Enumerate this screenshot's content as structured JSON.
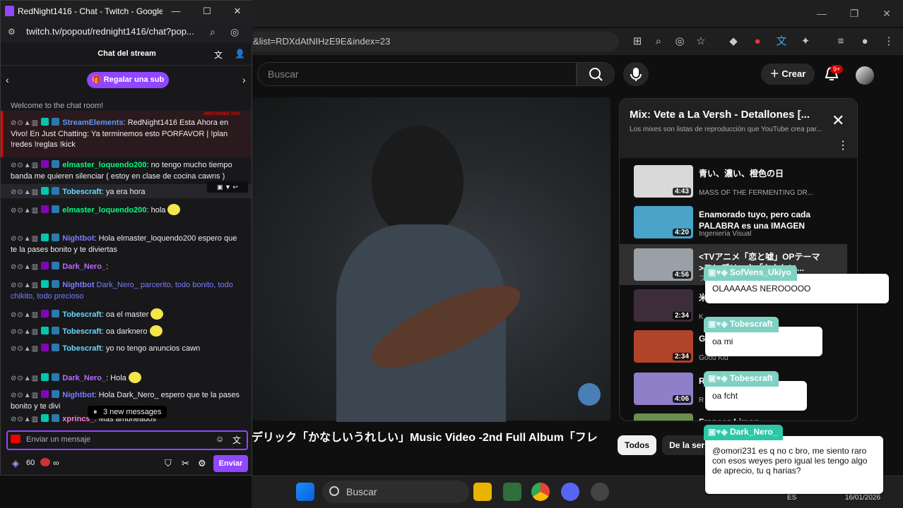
{
  "chrome": {
    "url_fragment": "&list=RDXdAtNIHzE9E&index=23",
    "window_controls": [
      "—",
      "❐",
      "✕"
    ]
  },
  "youtube": {
    "search_placeholder": "Buscar",
    "create_label": "Crear",
    "notif_badge": "9+",
    "video_title": "デリック「かなしいうれしい」Music Video -2nd Full Album「フレ",
    "filters": [
      "Todos",
      "De la serie"
    ],
    "playlist": {
      "title": "Mix: Vete a La Versh - Detallones [...",
      "subtitle": "Los mixes son listas de reproducción que YouTube crea par...",
      "items": [
        {
          "title": "青い、濃い、橙色の日",
          "channel": "MASS OF THE FERMENTING DR...",
          "duration": "4:43",
          "color": "#d9d9d9"
        },
        {
          "title": "Enamorado tuyo, pero cada PALABRA es una IMAGEN de...",
          "channel": "Ingeniería Visual",
          "duration": "4:20",
          "color": "#4aa3c9"
        },
        {
          "title": "<TVアニメ「恋と嘘」OPテーマ>フレデリック「かなしい...",
          "channel": "フ",
          "duration": "4:56",
          "color": "#9aa0a8"
        },
        {
          "title": "米 OUT",
          "channel": "K",
          "duration": "2:34",
          "color": "#3d2c3a"
        },
        {
          "title": "G (",
          "channel": "Good Kid",
          "duration": "2:34",
          "color": "#b0442a"
        },
        {
          "title": "R M",
          "channel": "R",
          "duration": "4:06",
          "color": "#8f7fc8"
        },
        {
          "title": "Frances Limon",
          "channel": "",
          "duration": "",
          "color": "#6a8f4e"
        }
      ]
    }
  },
  "taskbar": {
    "search_label": "Buscar",
    "lang": "ES",
    "date": "16/01/2026"
  },
  "twitch": {
    "window_title": "RedNight1416 - Chat - Twitch - Google...",
    "url": "twitch.tv/popout/rednight1416/chat?pop...",
    "header_title": "Chat del stream",
    "gift_label": "Regalar una sub",
    "welcome": "Welcome to the chat room!",
    "mentions_tag": "MENTIONED YOU",
    "messages": [
      {
        "user": "StreamElements",
        "color": "#5d98f2",
        "text": ": RedNight1416 Esta Ahora en Vivo! En Just Chatting: Ya terminemos esto PORFAVOR | !plan !redes !reglas !kick"
      },
      {
        "user": "elmaster_loquendo200",
        "color": "#00ff7f",
        "text": ": no tengo mucho tiempo banda me quieren silenciar ( estoy en clase de cocina cawns )"
      },
      {
        "user": "Tobescraft",
        "color": "#6ad8ff",
        "text": ": ya era hora"
      },
      {
        "user": "elmaster_loquendo200",
        "color": "#00ff7f",
        "text": ": hola"
      },
      {
        "user": "Nightbot",
        "color": "#7c7cff",
        "text": ": Hola elmaster_loquendo200 espero que te la pases bonito y te diviertas"
      },
      {
        "user": "Dark_Nero_",
        "color": "#b56cff",
        "text": ":"
      },
      {
        "user": "Nightbot",
        "color": "#7c7cff",
        "text": " Dark_Nero_ parcerito, todo bonito, todo chikito, todo precioso"
      },
      {
        "user": "Tobescraft",
        "color": "#6ad8ff",
        "text": ": oa el master"
      },
      {
        "user": "Tobescraft",
        "color": "#6ad8ff",
        "text": ": oa darknero"
      },
      {
        "user": "Tobescraft",
        "color": "#6ad8ff",
        "text": ": yo no tengo anuncios cawn"
      },
      {
        "user": "Dark_Nero_",
        "color": "#b56cff",
        "text": ": Hola"
      },
      {
        "user": "Nightbot",
        "color": "#7c7cff",
        "text": ": Hola Dark_Nero_ espero que te la pases bonito y te divi"
      },
      {
        "user": "xprincs_",
        "color": "#ff7fd0",
        "text": ": Más ambrieados"
      }
    ],
    "new_messages": "3 new messages",
    "input_placeholder": "Enviar un mensaje",
    "points": "60",
    "points_suffix": "∞",
    "send_label": "Enviar"
  },
  "overlay": [
    {
      "user": "SofVens_Ukiyo",
      "text": "OLAAAAAS NEROOOOO"
    },
    {
      "user": "Tobescraft",
      "text": "oa mi"
    },
    {
      "user": "Tobescraft",
      "text": "oa fcht"
    },
    {
      "user": "Dark_Nero_",
      "text": "@omori231 es q no c bro, me siento raro con esos weyes pero igual les tengo algo de aprecio, tu q harias?"
    }
  ]
}
